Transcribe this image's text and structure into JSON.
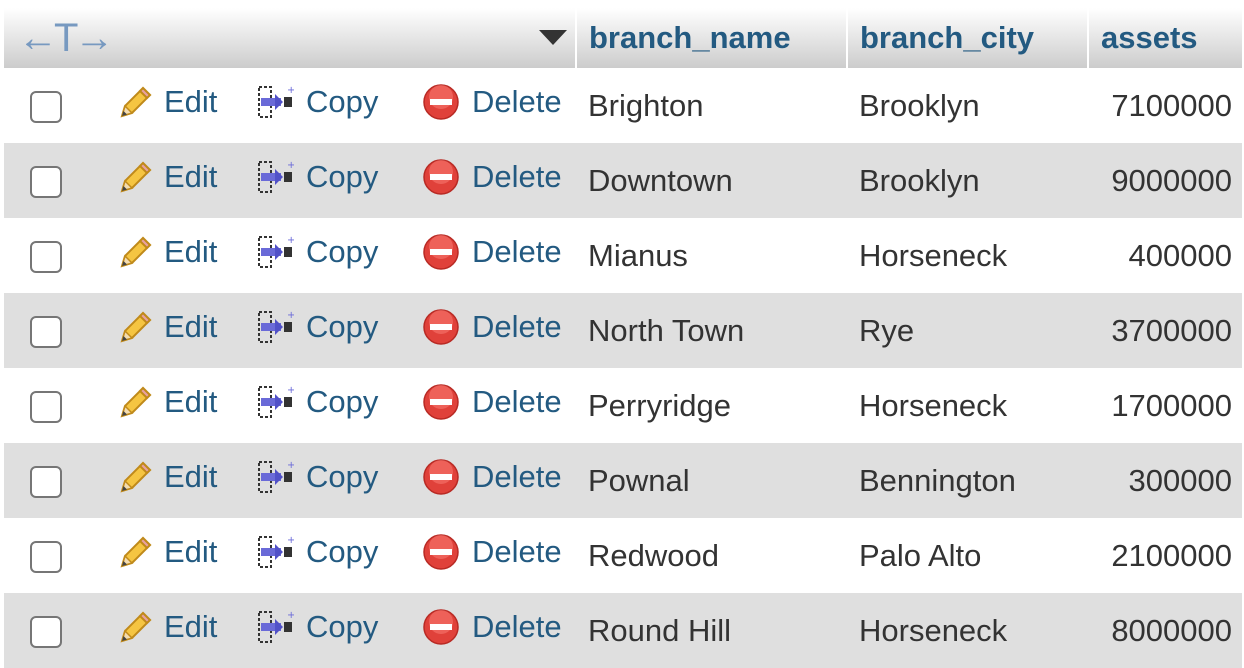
{
  "header": {
    "arrows_glyph": "←T→",
    "columns": [
      "branch_name",
      "branch_city",
      "assets"
    ]
  },
  "actions": {
    "edit_label": "Edit",
    "copy_label": "Copy",
    "delete_label": "Delete"
  },
  "colors": {
    "link": "#235a81",
    "row_alt": "#dfdfdf",
    "delete_icon": "#e0413a"
  },
  "rows": [
    {
      "branch_name": "Brighton",
      "branch_city": "Brooklyn",
      "assets": "7100000"
    },
    {
      "branch_name": "Downtown",
      "branch_city": "Brooklyn",
      "assets": "9000000"
    },
    {
      "branch_name": "Mianus",
      "branch_city": "Horseneck",
      "assets": "400000"
    },
    {
      "branch_name": "North Town",
      "branch_city": "Rye",
      "assets": "3700000"
    },
    {
      "branch_name": "Perryridge",
      "branch_city": "Horseneck",
      "assets": "1700000"
    },
    {
      "branch_name": "Pownal",
      "branch_city": "Bennington",
      "assets": "300000"
    },
    {
      "branch_name": "Redwood",
      "branch_city": "Palo Alto",
      "assets": "2100000"
    },
    {
      "branch_name": "Round Hill",
      "branch_city": "Horseneck",
      "assets": "8000000"
    }
  ]
}
